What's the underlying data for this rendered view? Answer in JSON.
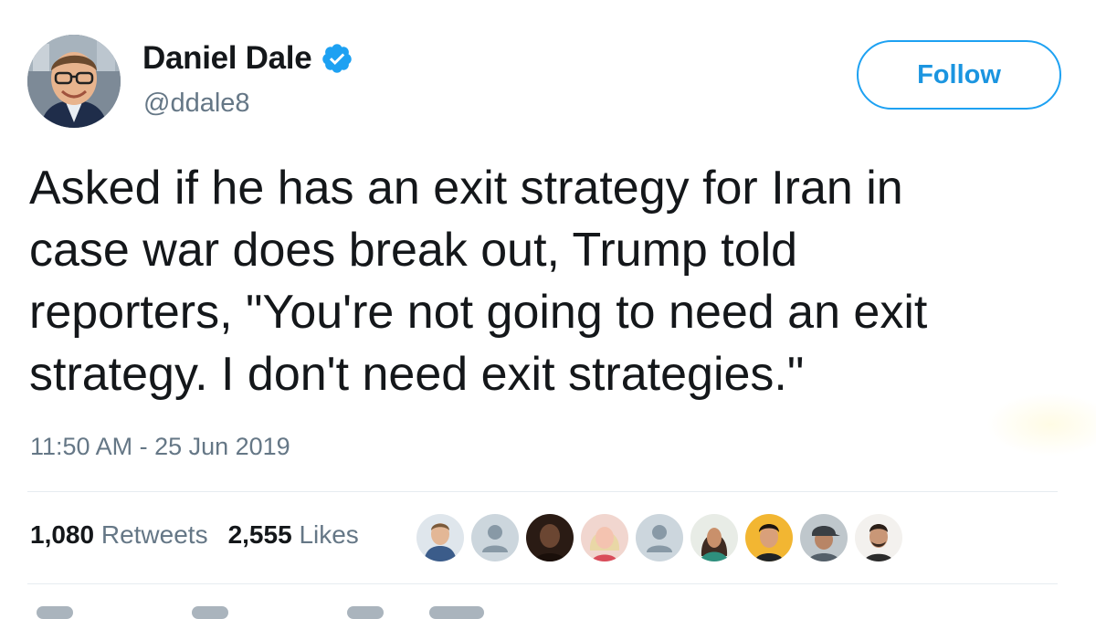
{
  "user": {
    "display_name": "Daniel Dale",
    "handle": "@ddale8",
    "verified_icon": "verified-badge-icon",
    "avatar_icon": "profile-photo"
  },
  "follow_button": {
    "label": "Follow"
  },
  "tweet": {
    "text_lines": [
      "Asked if he has an exit strategy for Iran in",
      "case war does break out, Trump told",
      "reporters, \"You're not going to need an exit",
      "strategy. I don't need exit strategies.\""
    ],
    "timestamp": "11:50 AM - 25 Jun 2019"
  },
  "stats": {
    "retweets_count": "1,080",
    "retweets_label": "Retweets",
    "likes_count": "2,555",
    "likes_label": "Likes"
  },
  "liker_avatars": [
    "man-in-suit-avatar",
    "default-avatar",
    "dark-photo-avatar",
    "woman-blonde-avatar",
    "default-avatar",
    "woman-scarf-avatar",
    "man-avatar",
    "man-cap-avatar",
    "man-beard-avatar"
  ],
  "colors": {
    "accent": "#1da1f2",
    "text": "#14171a",
    "muted": "#657786",
    "divider": "#e6ecf0"
  }
}
